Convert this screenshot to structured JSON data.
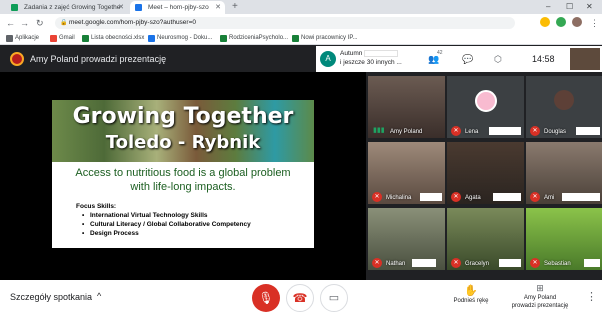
{
  "browser": {
    "tabs": [
      {
        "title": "Zadania z zajęć Growing Togethe",
        "favicon_color": "#0f9d58"
      },
      {
        "title": "Meet – hom-pjby-szo",
        "favicon_color": "#1a73e8"
      }
    ],
    "new_tab": "+",
    "url": "meet.google.com/hom-pjby-szo?authuser=0",
    "bookmarks": [
      {
        "label": "Aplikacje",
        "color": "#5f6368"
      },
      {
        "label": "Gmail",
        "color": "#ea4335"
      },
      {
        "label": "Lista obecności.xlsx",
        "color": "#188038"
      },
      {
        "label": "Neurosmog - Doku...",
        "color": "#1a73e8"
      },
      {
        "label": "RodziceniaPsycholo...",
        "color": "#188038"
      },
      {
        "label": "Nowi pracownicy IP...",
        "color": "#188038"
      }
    ]
  },
  "meet": {
    "presenter_banner": "Amy Poland prowadzi prezentację",
    "sidebar": {
      "avatar_letter": "A",
      "line1": "Autumn",
      "line2": "i jeszcze 30 innych ...",
      "participants_count": "42",
      "time": "14:58"
    },
    "slide": {
      "title1": "Growing Together",
      "title2": "Toledo - Rybnik",
      "body": "Access to nutritious food is a global problem with life-long impacts.",
      "focus_heading": "Focus Skills:",
      "focus_items": [
        "International Virtual Technology Skills",
        "Cultural Literacy / Global Collaborative Competency",
        "Design Process"
      ]
    },
    "tiles": [
      {
        "name": "Amy Poland",
        "muted": false
      },
      {
        "name": "Lena",
        "muted": true
      },
      {
        "name": "Douglas",
        "muted": true
      },
      {
        "name": "Michalina",
        "muted": true
      },
      {
        "name": "Agata",
        "muted": true
      },
      {
        "name": "Ami",
        "muted": true
      },
      {
        "name": "Nathan",
        "muted": true
      },
      {
        "name": "Gracelyn",
        "muted": true
      },
      {
        "name": "Sebastian",
        "muted": true
      }
    ],
    "bottom": {
      "details_label": "Szczegóły spotkania",
      "raise_hand_label": "Podnieś rękę",
      "presenting_label_1": "Amy Poland",
      "presenting_label_2": "prowadzi prezentację"
    }
  }
}
